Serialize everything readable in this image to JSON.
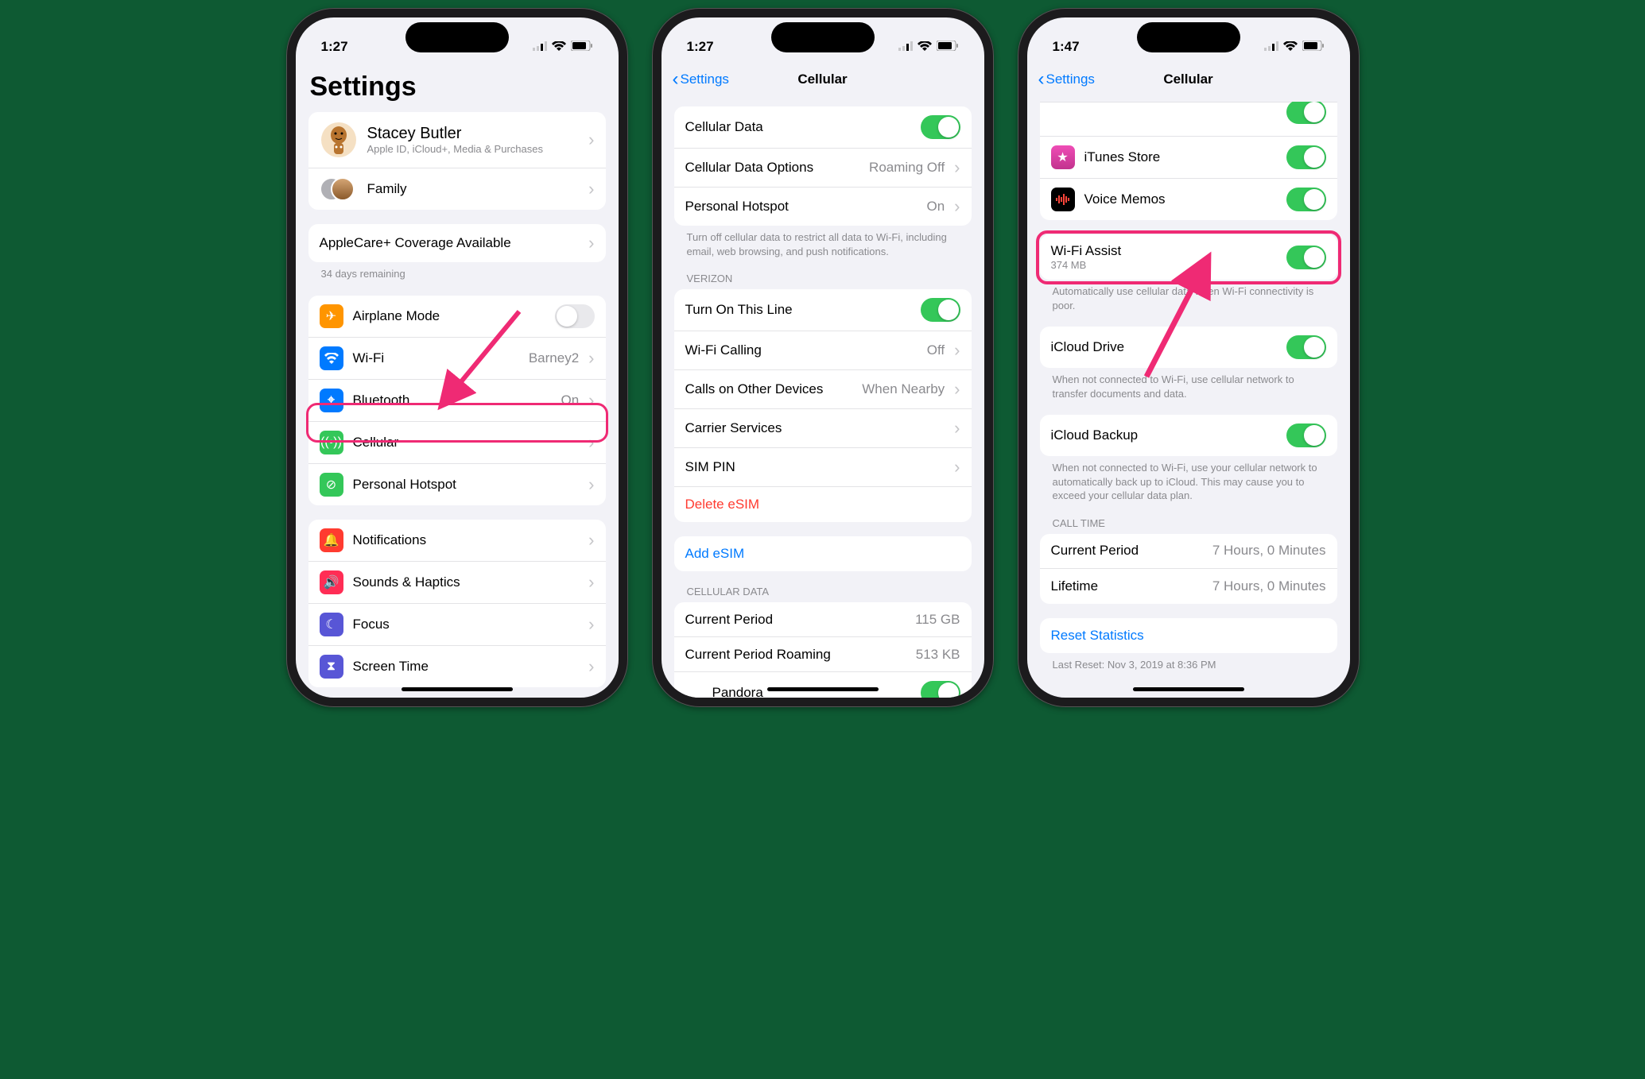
{
  "phone1": {
    "time": "1:27",
    "title": "Settings",
    "profile": {
      "name": "Stacey Butler",
      "subtitle": "Apple ID, iCloud+, Media & Purchases"
    },
    "family_label": "Family",
    "applecare_label": "AppleCare+ Coverage Available",
    "applecare_footer": "34 days remaining",
    "rows": {
      "airplane": "Airplane Mode",
      "wifi": "Wi-Fi",
      "wifi_val": "Barney2",
      "bluetooth": "Bluetooth",
      "bluetooth_val": "On",
      "cellular": "Cellular",
      "hotspot": "Personal Hotspot",
      "notifications": "Notifications",
      "sounds": "Sounds & Haptics",
      "focus": "Focus",
      "screentime": "Screen Time"
    }
  },
  "phone2": {
    "time": "1:27",
    "back": "Settings",
    "title": "Cellular",
    "cellular_data": "Cellular Data",
    "cellular_options": "Cellular Data Options",
    "cellular_options_val": "Roaming Off",
    "hotspot": "Personal Hotspot",
    "hotspot_val": "On",
    "footer1": "Turn off cellular data to restrict all data to Wi-Fi, including email, web browsing, and push notifications.",
    "carrier_header": "VERIZON",
    "turn_on": "Turn On This Line",
    "wifi_calling": "Wi-Fi Calling",
    "wifi_calling_val": "Off",
    "other_devices": "Calls on Other Devices",
    "other_devices_val": "When Nearby",
    "carrier_services": "Carrier Services",
    "sim_pin": "SIM PIN",
    "delete_esim": "Delete eSIM",
    "add_esim": "Add eSIM",
    "cellular_data_header": "CELLULAR DATA",
    "current_period": "Current Period",
    "current_period_val": "115 GB",
    "roaming": "Current Period Roaming",
    "roaming_val": "513 KB",
    "pandora": "Pandora"
  },
  "phone3": {
    "time": "1:47",
    "back": "Settings",
    "title": "Cellular",
    "itunes": "iTunes Store",
    "voice_memos": "Voice Memos",
    "wifi_assist": "Wi-Fi Assist",
    "wifi_assist_sub": "374 MB",
    "wifi_assist_footer": "Automatically use cellular data when Wi-Fi connectivity is poor.",
    "icloud_drive": "iCloud Drive",
    "icloud_drive_footer": "When not connected to Wi-Fi, use cellular network to transfer documents and data.",
    "icloud_backup": "iCloud Backup",
    "icloud_backup_footer": "When not connected to Wi-Fi, use your cellular network to automatically back up to iCloud. This may cause you to exceed your cellular data plan.",
    "call_time_header": "CALL TIME",
    "ct_current": "Current Period",
    "ct_current_val": "7 Hours, 0 Minutes",
    "ct_lifetime": "Lifetime",
    "ct_lifetime_val": "7 Hours, 0 Minutes",
    "reset": "Reset Statistics",
    "last_reset": "Last Reset: Nov 3, 2019 at 8:36 PM"
  }
}
